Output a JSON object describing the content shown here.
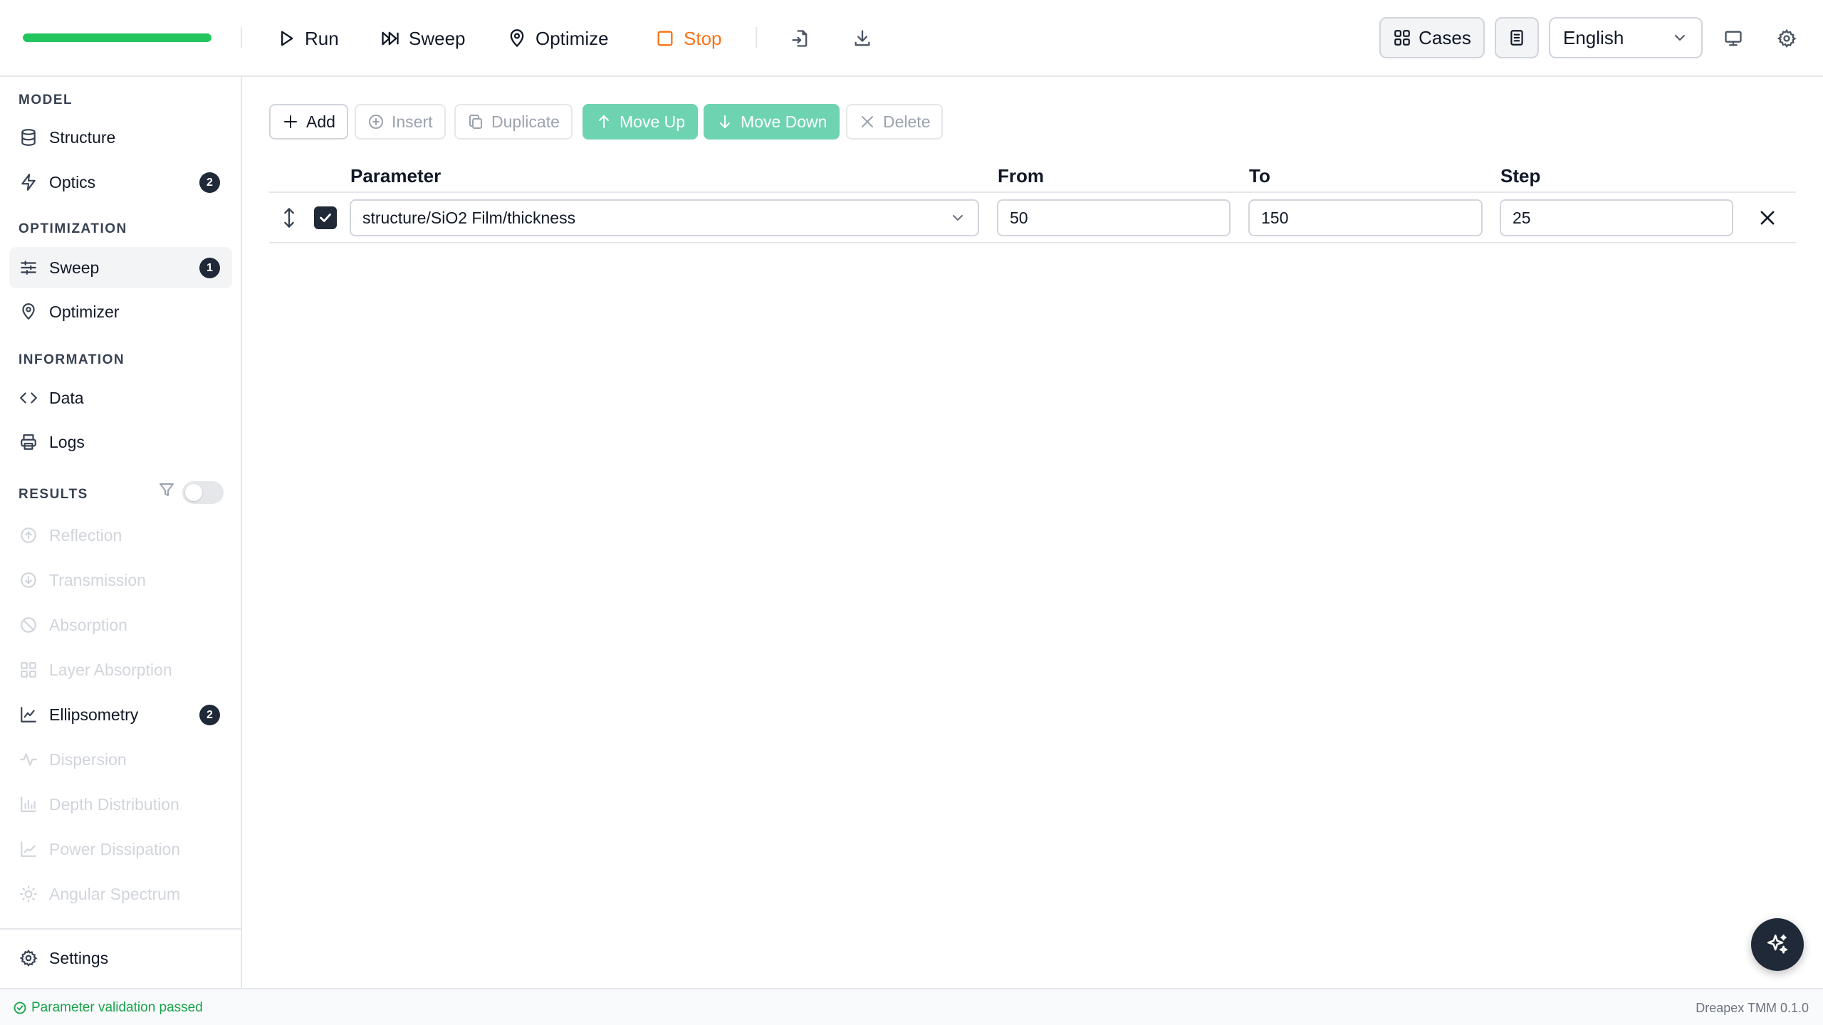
{
  "toolbar": {
    "progress": 1.0,
    "run_label": "Run",
    "sweep_label": "Sweep",
    "optimize_label": "Optimize",
    "stop_label": "Stop",
    "cases_label": "Cases",
    "language": "English"
  },
  "sidebar": {
    "sections": {
      "model": "MODEL",
      "optimization": "OPTIMIZATION",
      "information": "INFORMATION",
      "results": "RESULTS"
    },
    "items": {
      "structure": "Structure",
      "optics": "Optics",
      "optics_badge": "2",
      "sweep": "Sweep",
      "sweep_badge": "1",
      "optimizer": "Optimizer",
      "data": "Data",
      "logs": "Logs",
      "reflection": "Reflection",
      "transmission": "Transmission",
      "absorption": "Absorption",
      "layer_absorption": "Layer Absorption",
      "ellipsometry": "Ellipsometry",
      "ellipsometry_badge": "2",
      "dispersion": "Dispersion",
      "depth_distribution": "Depth Distribution",
      "power_dissipation": "Power Dissipation",
      "angular_spectrum": "Angular Spectrum",
      "settings": "Settings"
    },
    "results_toggle_on": false
  },
  "actions": {
    "add": "Add",
    "insert": "Insert",
    "duplicate": "Duplicate",
    "move_up": "Move Up",
    "move_down": "Move Down",
    "delete": "Delete"
  },
  "table": {
    "headers": {
      "parameter": "Parameter",
      "from": "From",
      "to": "To",
      "step": "Step"
    },
    "rows": [
      {
        "checked": true,
        "parameter": "structure/SiO2 Film/thickness",
        "from": "50",
        "to": "150",
        "step": "25"
      }
    ]
  },
  "status": {
    "message": "Parameter validation passed",
    "version": "Dreapex TMM 0.1.0"
  },
  "colors": {
    "accent": "#6ed3b0",
    "progress": "#22c55e",
    "stop": "#f97316",
    "status_ok": "#16a34a"
  }
}
